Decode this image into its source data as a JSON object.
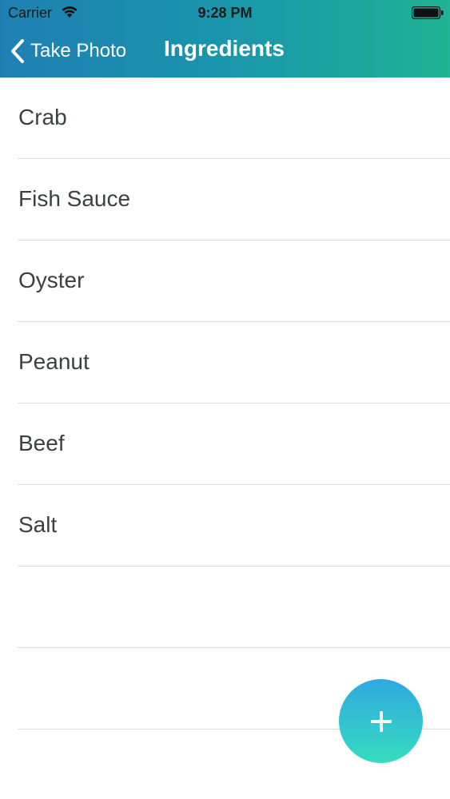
{
  "status_bar": {
    "carrier": "Carrier",
    "time": "9:28 PM"
  },
  "nav": {
    "back_label": "Take Photo",
    "title": "Ingredients"
  },
  "ingredients": [
    {
      "label": "Crab"
    },
    {
      "label": "Fish Sauce"
    },
    {
      "label": "Oyster"
    },
    {
      "label": "Peanut"
    },
    {
      "label": "Beef"
    },
    {
      "label": "Salt"
    },
    {
      "label": ""
    },
    {
      "label": ""
    }
  ],
  "colors": {
    "header_gradient_start": "#1f7fb3",
    "header_gradient_end": "#1fb294",
    "fab_gradient_top": "#2fa9e0",
    "fab_gradient_bottom": "#36dcc0",
    "row_text": "#3c3f44",
    "divider": "#dcdcdc"
  },
  "icons": {
    "back": "chevron-left-icon",
    "add": "plus-icon",
    "wifi": "wifi-icon",
    "battery": "battery-icon"
  }
}
